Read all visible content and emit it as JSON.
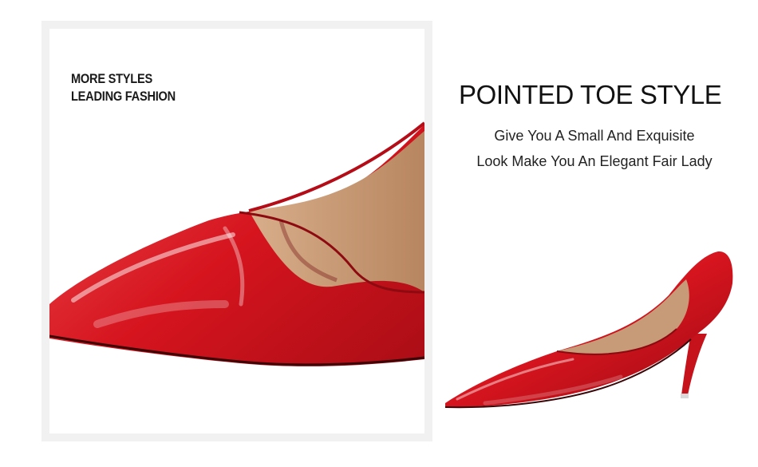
{
  "closeup": {
    "tagline_line1": "MORE STYLES",
    "tagline_line2": "LEADING FASHION"
  },
  "feature": {
    "title": "POINTED TOE STYLE",
    "line1": "Give You A Small And Exquisite",
    "line2": "Look Make You An Elegant Fair Lady"
  },
  "colors": {
    "shoe_red": "#d5141e",
    "lining_tan": "#c79a78",
    "frame_gray": "#f1f1f1"
  }
}
